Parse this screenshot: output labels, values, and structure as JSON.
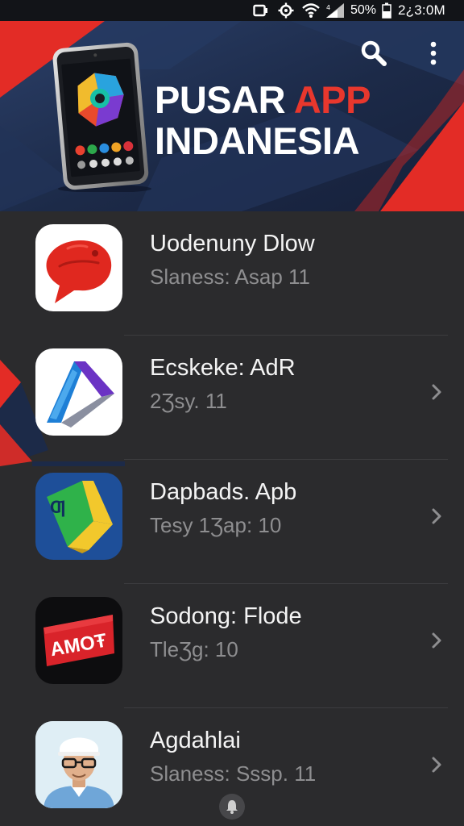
{
  "status_bar": {
    "battery_percent": "50%",
    "time": "2¿3:0M",
    "icons": [
      "screen-icon",
      "settings-icon",
      "wifi-icon",
      "signal-icon",
      "battery-icon"
    ]
  },
  "header": {
    "title_line1_word1": "PUSAR",
    "title_line1_word2": "APP",
    "title_line2": "INDANESIA",
    "accent_color": "#e8372d",
    "background_color": "#1d2c4c",
    "actions": [
      "search-icon",
      "more-vert-icon"
    ]
  },
  "apps": [
    {
      "title": "Uodenuny Dlow",
      "subtitle": "Slaness: Asap 11",
      "has_chevron": false,
      "icon": "red-bubble-icon"
    },
    {
      "title": "Ecskeke: AdR",
      "subtitle": "2Ʒsy. 11",
      "has_chevron": true,
      "icon": "play-triangle-icon"
    },
    {
      "title": "Dapbads. Apb",
      "subtitle": "Tesy 1Ʒap: 10",
      "has_chevron": true,
      "icon": "green-yellow-arrow-icon"
    },
    {
      "title": "Sodong: Flode",
      "subtitle": "TleƷg: 10",
      "has_chevron": true,
      "icon": "red-video-badge-icon"
    },
    {
      "title": "Agdahlai",
      "subtitle": "Slaness: Sssp. 11",
      "has_chevron": true,
      "icon": "person-portrait-icon"
    }
  ],
  "icon_text": {
    "app3_badge": "Ƣ",
    "app4_badge": "AMOŦ"
  },
  "colors": {
    "background": "#2b2b2d",
    "title_text": "#f4f4f4",
    "subtitle_text": "#8e8e90",
    "brand_red": "#e8372d"
  }
}
